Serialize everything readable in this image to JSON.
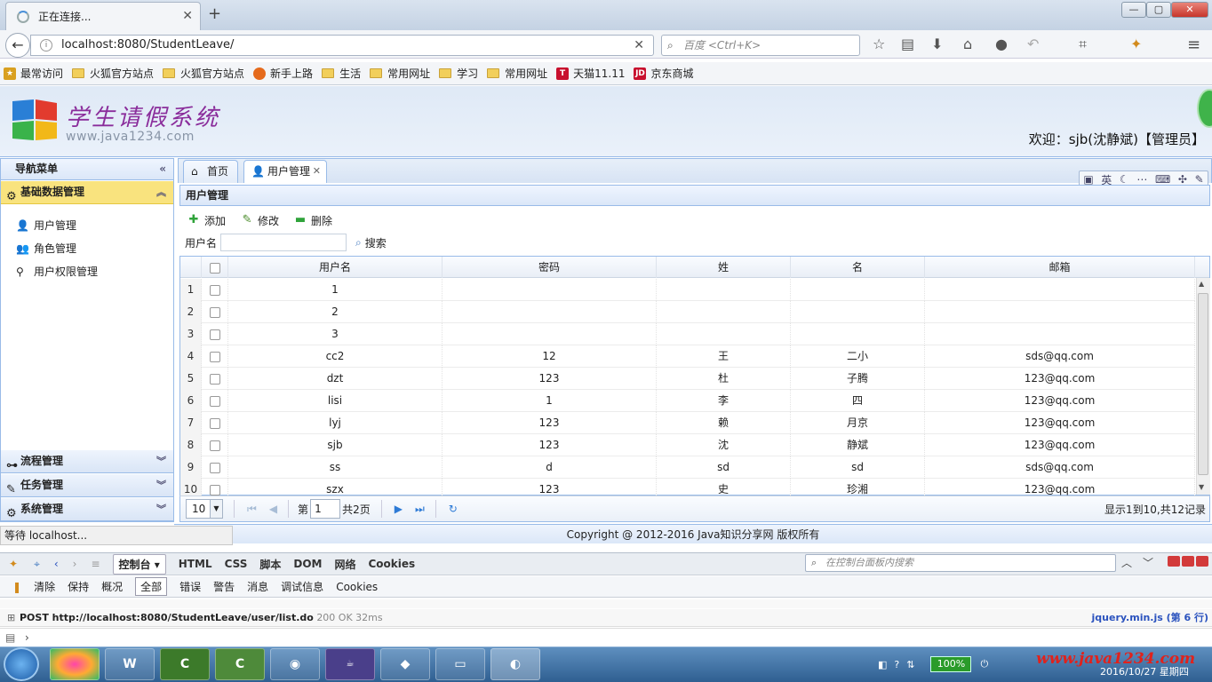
{
  "browser": {
    "tab_title": "正在连接...",
    "url": "localhost:8080/StudentLeave/",
    "search_placeholder": "百度 <Ctrl+K>",
    "bookmarks": [
      "最常访问",
      "火狐官方站点",
      "火狐官方站点",
      "新手上路",
      "生活",
      "常用网址",
      "学习",
      "常用网址",
      "天猫11.11",
      "京东商城"
    ]
  },
  "app": {
    "title": "学生请假系统",
    "site": "www.java1234.com",
    "welcome": "欢迎：sjb(沈静斌)【管理员】",
    "copyright": "Copyright @ 2012-2016 Java知识分享网 版权所有",
    "status": "等待 localhost..."
  },
  "sidebar": {
    "header": "导航菜单",
    "sections": [
      {
        "label": "基础数据管理",
        "items": [
          "用户管理",
          "角色管理",
          "用户权限管理"
        ]
      },
      {
        "label": "流程管理"
      },
      {
        "label": "任务管理"
      },
      {
        "label": "系统管理"
      }
    ]
  },
  "tabs": [
    "首页",
    "用户管理"
  ],
  "ime": [
    "英"
  ],
  "panel": {
    "title": "用户管理",
    "toolbar": {
      "add": "添加",
      "edit": "修改",
      "delete": "删除"
    },
    "search_label": "用户名",
    "search_btn": "搜索",
    "columns": [
      "用户名",
      "密码",
      "姓",
      "名",
      "邮箱"
    ],
    "rows": [
      {
        "n": "1",
        "user": "1",
        "pwd": "",
        "last": "",
        "first": "",
        "email": ""
      },
      {
        "n": "2",
        "user": "2",
        "pwd": "",
        "last": "",
        "first": "",
        "email": ""
      },
      {
        "n": "3",
        "user": "3",
        "pwd": "",
        "last": "",
        "first": "",
        "email": ""
      },
      {
        "n": "4",
        "user": "cc2",
        "pwd": "12",
        "last": "王",
        "first": "二小",
        "email": "sds@qq.com"
      },
      {
        "n": "5",
        "user": "dzt",
        "pwd": "123",
        "last": "杜",
        "first": "子腾",
        "email": "123@qq.com"
      },
      {
        "n": "6",
        "user": "lisi",
        "pwd": "1",
        "last": "李",
        "first": "四",
        "email": "123@qq.com"
      },
      {
        "n": "7",
        "user": "lyj",
        "pwd": "123",
        "last": "赖",
        "first": "月京",
        "email": "123@qq.com"
      },
      {
        "n": "8",
        "user": "sjb",
        "pwd": "123",
        "last": "沈",
        "first": "静斌",
        "email": "123@qq.com"
      },
      {
        "n": "9",
        "user": "ss",
        "pwd": "d",
        "last": "sd",
        "first": "sd",
        "email": "sds@qq.com"
      },
      {
        "n": "10",
        "user": "szx",
        "pwd": "123",
        "last": "史",
        "first": "珍湘",
        "email": "123@qq.com"
      }
    ],
    "pager": {
      "size": "10",
      "page_prefix": "第",
      "page": "1",
      "total": "共2页",
      "info": "显示1到10,共12记录"
    }
  },
  "firebug": {
    "tabs": [
      "控制台",
      "HTML",
      "CSS",
      "脚本",
      "DOM",
      "网络",
      "Cookies"
    ],
    "search_placeholder": "在控制台面板内搜索",
    "filters": [
      "清除",
      "保持",
      "概况",
      "全部",
      "错误",
      "警告",
      "消息",
      "调试信息",
      "Cookies"
    ],
    "log": {
      "request": "POST http://localhost:8080/StudentLeave/user/list.do",
      "status": "200 OK 32ms",
      "source": "jquery.min.js (第 6 行)"
    }
  },
  "taskbar": {
    "battery": "100%",
    "clock": "2016/10/27 星期四",
    "watermark": "www.java1234.com"
  }
}
